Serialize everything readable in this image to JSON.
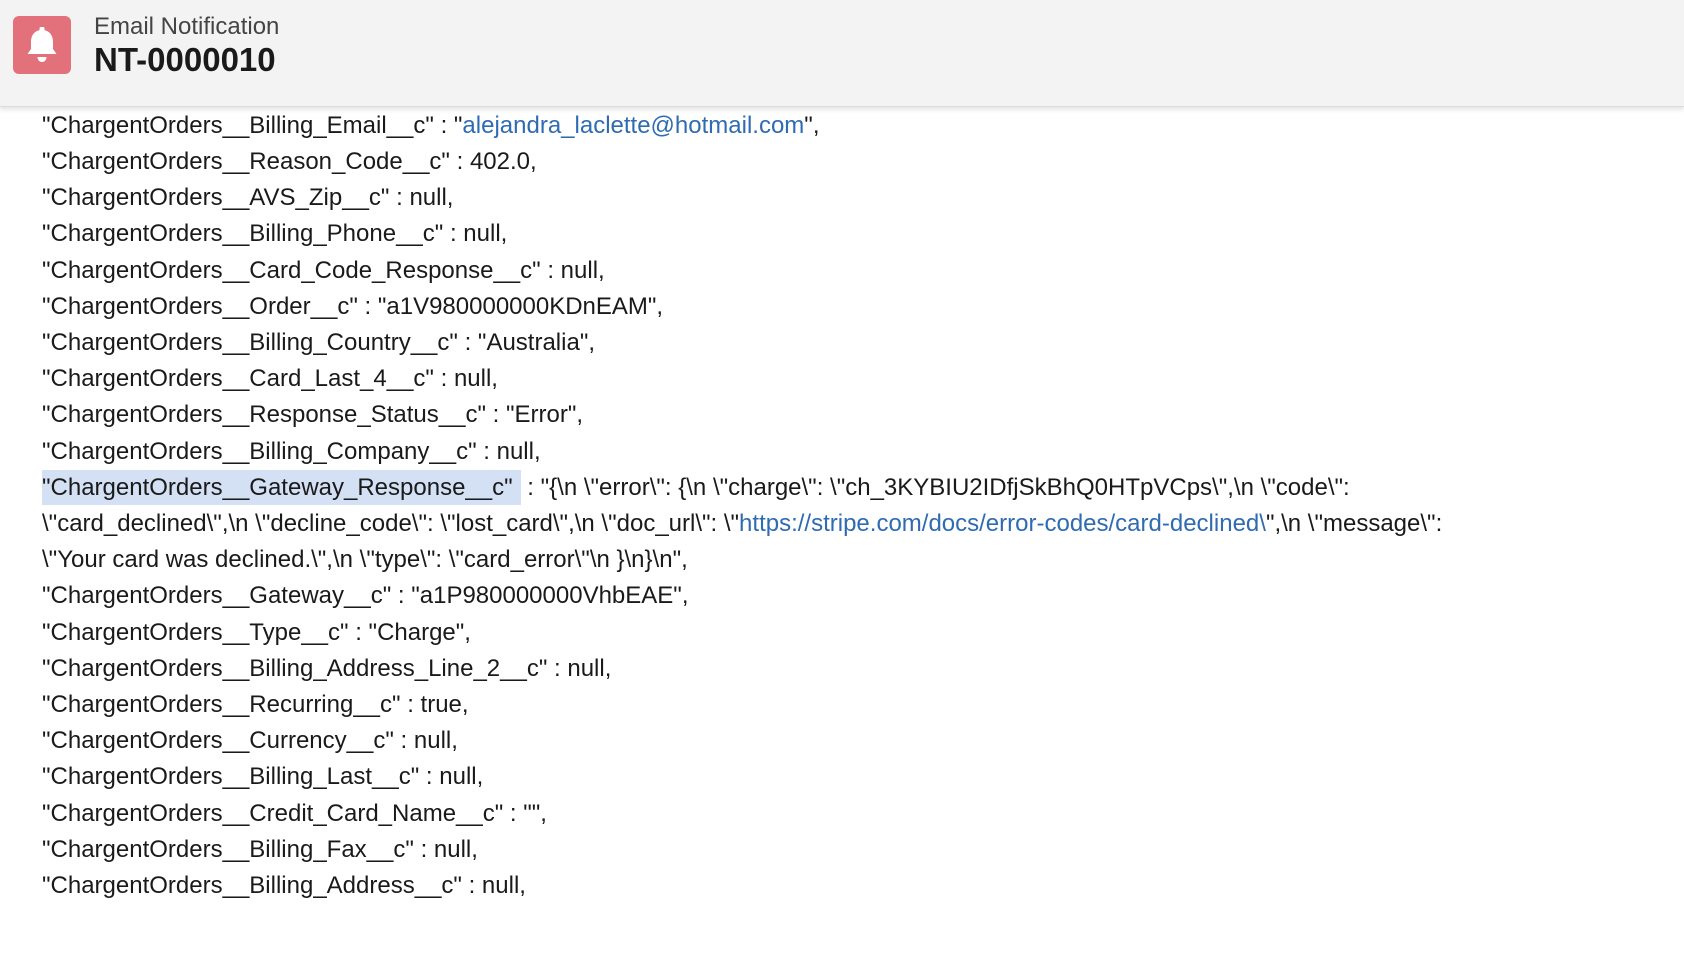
{
  "header": {
    "icon": "bell-icon",
    "object_type": "Email Notification",
    "record_name": "NT-0000010"
  },
  "colors": {
    "icon_bg": "#e3717c",
    "link": "#2f6bb3",
    "selection": "#d4e0f4",
    "header_bg": "#f3f3f3"
  },
  "body": {
    "lines": [
      {
        "pre": "\"ChargentOrders__Billing_Email__c\" : \"",
        "link": "alejandra_laclette@hotmail.com",
        "post": "\","
      },
      {
        "text": "\"ChargentOrders__Reason_Code__c\" : 402.0,"
      },
      {
        "text": "\"ChargentOrders__AVS_Zip__c\" : null,"
      },
      {
        "text": "\"ChargentOrders__Billing_Phone__c\" : null,"
      },
      {
        "text": "\"ChargentOrders__Card_Code_Response__c\" : null,"
      },
      {
        "text": "\"ChargentOrders__Order__c\" : \"a1V980000000KDnEAM\","
      },
      {
        "text": "\"ChargentOrders__Billing_Country__c\" : \"Australia\","
      },
      {
        "text": "\"ChargentOrders__Card_Last_4__c\" : null,"
      },
      {
        "text": "\"ChargentOrders__Response_Status__c\" : \"Error\","
      },
      {
        "text": "\"ChargentOrders__Billing_Company__c\" : null,"
      },
      {
        "highlight": "\"ChargentOrders__Gateway_Response__c\"",
        "post": " : \"{\\n \\\"error\\\": {\\n \\\"charge\\\": \\\"ch_3KYBIU2IDfjSkBhQ0HTpVCps\\\",\\n \\\"code\\\":"
      },
      {
        "pre": "\\\"card_declined\\\",\\n \\\"decline_code\\\": \\\"lost_card\\\",\\n \\\"doc_url\\\": \\\"",
        "link": "https://stripe.com/docs/error-codes/card-declined\\",
        "post": "\",\\n \\\"message\\\":"
      },
      {
        "text": "\\\"Your card was declined.\\\",\\n \\\"type\\\": \\\"card_error\\\"\\n }\\n}\\n\","
      },
      {
        "text": "\"ChargentOrders__Gateway__c\" : \"a1P980000000VhbEAE\","
      },
      {
        "text": "\"ChargentOrders__Type__c\" : \"Charge\","
      },
      {
        "text": "\"ChargentOrders__Billing_Address_Line_2__c\" : null,"
      },
      {
        "text": "\"ChargentOrders__Recurring__c\" : true,"
      },
      {
        "text": "\"ChargentOrders__Currency__c\" : null,"
      },
      {
        "text": "\"ChargentOrders__Billing_Last__c\" : null,"
      },
      {
        "text": "\"ChargentOrders__Credit_Card_Name__c\" : \"\","
      },
      {
        "text": "\"ChargentOrders__Billing_Fax__c\" : null,"
      },
      {
        "text": "\"ChargentOrders__Billing_Address__c\" : null,"
      }
    ]
  }
}
